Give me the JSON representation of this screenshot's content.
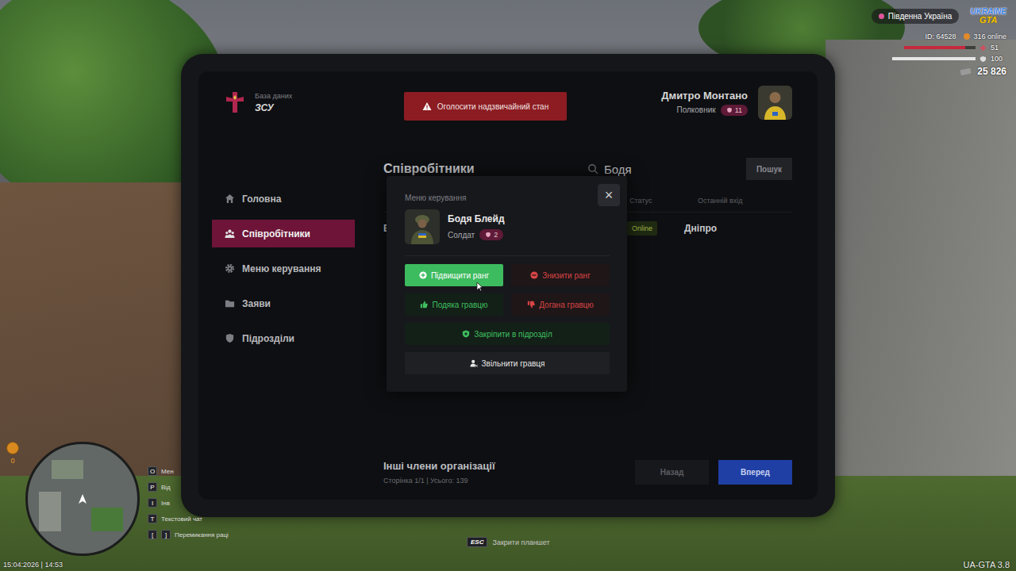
{
  "hud": {
    "region": "Південна Україна",
    "logo": {
      "top": "UKRAINE",
      "bottom": "GTA"
    },
    "player_id": "ID: 64528",
    "online": "316 online",
    "health": {
      "reading": "51",
      "level": 0.85
    },
    "armor": {
      "reading": "100",
      "level": 1
    },
    "money": "25 826",
    "coins": "0",
    "key_hints": [
      {
        "keys": [
          "O"
        ],
        "label": "Мен"
      },
      {
        "keys": [
          "P"
        ],
        "label": "Від"
      },
      {
        "keys": [
          "I"
        ],
        "label": "Інв"
      },
      {
        "keys": [
          "T"
        ],
        "label": "Текстовий чат"
      },
      {
        "keys": [
          "[",
          "]"
        ],
        "label": "Перемикання раці"
      }
    ],
    "datetime": "15:04:2026 | 14:53",
    "close_hint": {
      "key": "ESC",
      "label": "Закрити планшет"
    },
    "version": "UA-GTA 3.8"
  },
  "tablet": {
    "brand": {
      "subtitle": "База даних",
      "title": "ЗСУ"
    },
    "emergency_button": "Оголосити надзвичайний стан",
    "user": {
      "name": "Дмитро Монтано",
      "rank": "Полковник",
      "rank_level": "11"
    },
    "sidebar": {
      "items": [
        {
          "label": "Головна",
          "selected": false
        },
        {
          "label": "Співробітники",
          "selected": true
        },
        {
          "label": "Меню керування",
          "selected": false
        },
        {
          "label": "Заяви",
          "selected": false
        },
        {
          "label": "Підрозділи",
          "selected": false
        }
      ]
    },
    "page": {
      "title": "Співробітники",
      "search": {
        "value": "Бодя"
      },
      "search_button": "Пошук",
      "table": {
        "columns": [
          "Статус",
          "Останній вхід"
        ],
        "rows": [
          {
            "name": "Б",
            "status": "Online",
            "last_login": "Дніпро"
          }
        ]
      },
      "footer": {
        "title": "Інші члени організації",
        "info": "Сторінка 1/1 | Усього: 139",
        "buttons": [
          {
            "label": "Назад",
            "kind": "secondary"
          },
          {
            "label": "Вперед",
            "kind": "primary"
          }
        ]
      }
    },
    "modal": {
      "title": "Меню керування",
      "close": "×",
      "member": {
        "name": "Бодя Блейд",
        "rank": "Солдат",
        "rank_level": "2"
      },
      "actions": [
        {
          "label": "Підвищити ранг",
          "tone": "positive",
          "hovered": true
        },
        {
          "label": "Знизити ранг",
          "tone": "negative",
          "hovered": false
        },
        {
          "label": "Подяка гравцю",
          "tone": "positive",
          "hovered": false
        },
        {
          "label": "Догана гравцю",
          "tone": "negative",
          "hovered": false
        },
        {
          "label": "Закріпити в підрозділ",
          "tone": "positive",
          "hovered": false
        },
        {
          "label": "Звільнити гравця",
          "tone": "neutral",
          "hovered": false
        }
      ]
    }
  }
}
